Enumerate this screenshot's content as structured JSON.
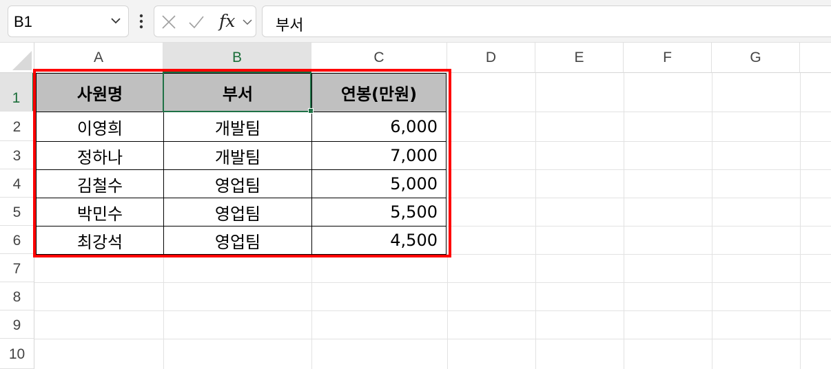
{
  "formula_bar": {
    "name_box": "B1",
    "formula_value": "부서",
    "fx_label": "fx",
    "icons": {
      "name_box_dropdown": "chevron-down-icon",
      "more": "more-vertical-icon",
      "cancel": "close-icon",
      "enter": "check-icon",
      "insert_function": "function-icon",
      "expand": "chevron-down-icon"
    }
  },
  "sheet": {
    "columns": [
      "A",
      "B",
      "C",
      "D",
      "E",
      "F",
      "G"
    ],
    "rows": [
      "1",
      "2",
      "3",
      "4",
      "5",
      "6",
      "7",
      "8",
      "9",
      "10"
    ],
    "active_cell": "B1",
    "table": {
      "headers": [
        "사원명",
        "부서",
        "연봉(만원)"
      ],
      "rows": [
        [
          "이영희",
          "개발팀",
          "6,000"
        ],
        [
          "정하나",
          "개발팀",
          "7,000"
        ],
        [
          "김철수",
          "영업팀",
          "5,000"
        ],
        [
          "박민수",
          "영업팀",
          "5,500"
        ],
        [
          "최강석",
          "영업팀",
          "4,500"
        ]
      ]
    }
  },
  "colors": {
    "header_fill": "#c0c0c0",
    "selection": "#1e7145",
    "highlight_box": "#ff0000"
  }
}
